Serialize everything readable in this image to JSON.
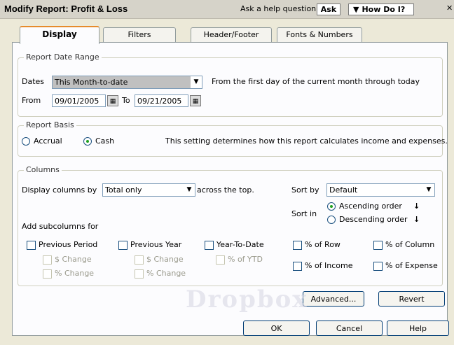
{
  "title": "Modify Report: Profit & Loss",
  "help": {
    "question": "Ask a help question",
    "ask": "Ask",
    "how_do_i": "How Do I?"
  },
  "tabs": [
    "Display",
    "Filters",
    "Header/Footer",
    "Fonts & Numbers"
  ],
  "date_range": {
    "legend": "Report Date Range",
    "dates_label": "Dates",
    "dates_value": "This Month-to-date",
    "dates_desc": "From the first day of the current month through today",
    "from_label": "From",
    "from_value": "09/01/2005",
    "to_label": "To",
    "to_value": "09/21/2005"
  },
  "basis": {
    "legend": "Report Basis",
    "accrual": "Accrual",
    "cash": "Cash",
    "selected": "cash",
    "desc": "This setting determines how this report calculates income and expenses."
  },
  "columns": {
    "legend": "Columns",
    "display_by_label": "Display columns by",
    "display_by_value": "Total only",
    "across": "across the top.",
    "sort_by_label": "Sort by",
    "sort_by_value": "Default",
    "sort_in_label": "Sort in",
    "ascending": "Ascending order",
    "descending": "Descending order",
    "sort_selected": "ascending",
    "add_sub": "Add subcolumns for",
    "prev_period": "Previous Period",
    "prev_year": "Previous Year",
    "ytd": "Year-To-Date",
    "dollar_change": "$ Change",
    "pct_change": "% Change",
    "pct_ytd": "% of YTD",
    "pct_row": "% of Row",
    "pct_column": "% of Column",
    "pct_income": "% of Income",
    "pct_expense": "% of Expense"
  },
  "buttons": {
    "advanced": "Advanced...",
    "revert": "Revert",
    "ok": "OK",
    "cancel": "Cancel",
    "help": "Help"
  },
  "watermark": "Dropbox"
}
